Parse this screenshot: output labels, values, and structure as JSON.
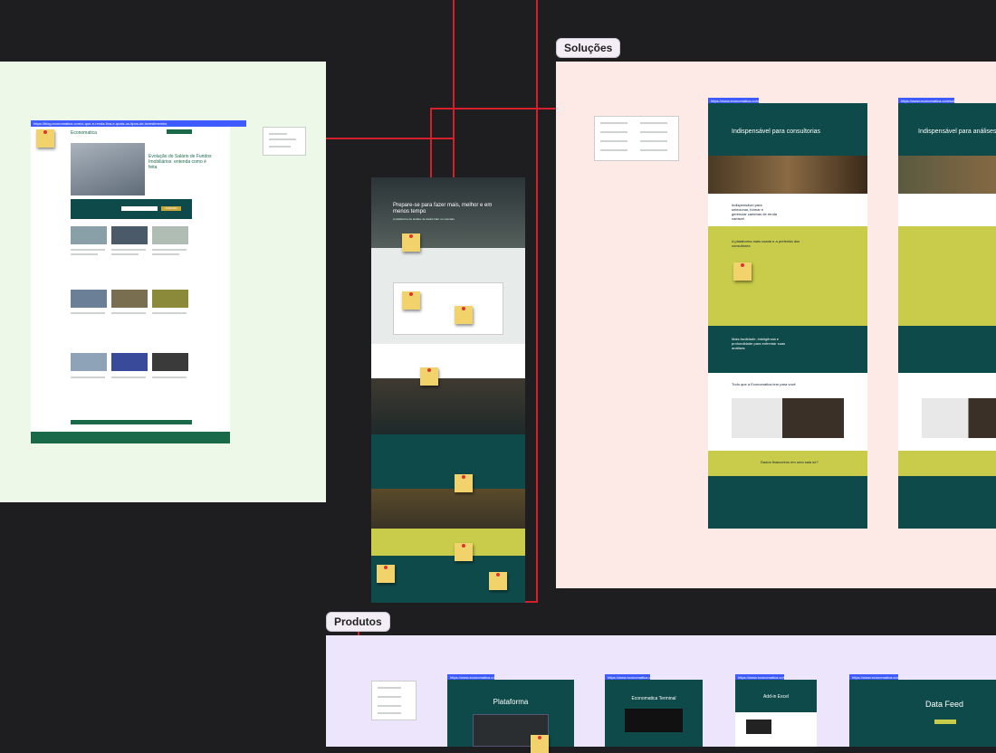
{
  "sections": {
    "solucoes_label": "Soluções",
    "produtos_label": "Produtos"
  },
  "home": {
    "hero_title": "Prepare-se para fazer mais, melhor e em menos tempo",
    "hero_subtitle": "A plataforma de análise de dados líder no mercado"
  },
  "consultorias": {
    "hero_title": "Indispensável para consultorias",
    "url": "https://www.economatica.com/solucoes/consultorias",
    "section_title": "Indispensável para selecionar, formar e gerenciar carteiras de renda variável",
    "lime_title": "A plataforma mais usada e a preferida dos consultores",
    "teal_title": "Mais facilidade, inteligência e profundidade para enfrentar suas análises",
    "tools_title": "Tudo que a Economatica tem para você",
    "cta": "Dados financeiros em uma sala só?"
  },
  "analises": {
    "hero_title": "Indispensável para análises avançadas",
    "url": "https://www.economatica.com/solucoes/analises"
  },
  "produtos": {
    "plataforma": "Plataforma",
    "terminal": "Economatica Terminal",
    "excel": "Add-in Excel",
    "datafeed": "Data Feed",
    "url1": "https://www.economatica.com/plataforma",
    "url2": "https://www.economatica.com/terminal",
    "url3": "https://www.economatica.com/excel",
    "url4": "https://www.economatica.com/data-feed"
  },
  "blog": {
    "url": "https://blog.economatica.com/o-que-e-renda-fixa-e-quais-os-tipos-de-investimentos",
    "brand": "Economatica",
    "featured_title": "Evolução do Salário de Fundos Imobiliários: entenda como é feita",
    "newsletter_button": "ASSINAR"
  },
  "colors": {
    "teal": "#0f4a4a",
    "lime": "#c8cc4a",
    "connector": "#d61f2c",
    "url_blue": "#3d5bff"
  }
}
